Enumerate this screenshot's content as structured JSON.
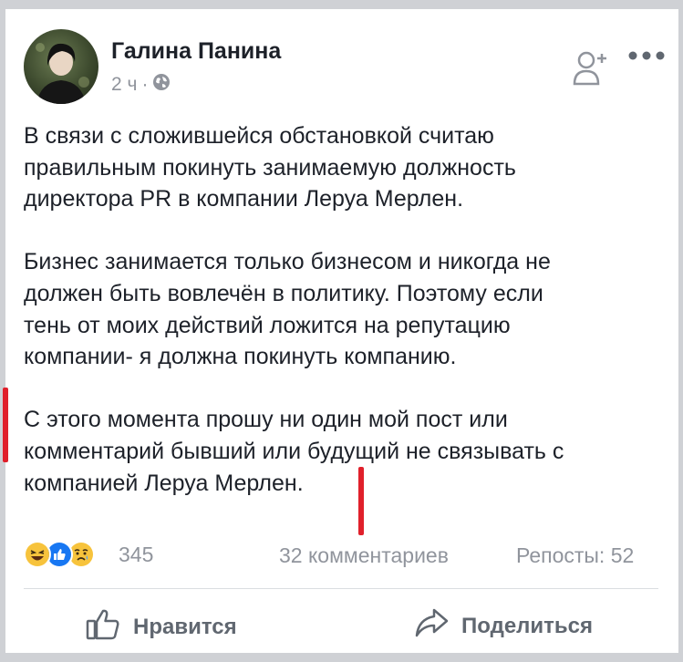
{
  "post": {
    "author": "Галина Панина",
    "time": "2 ч",
    "separator": "·",
    "privacy_icon": "globe-icon",
    "paragraphs": [
      "В связи с сложившейся обстановкой считаю\nправильным покинуть занимаемую должность\nдиректора PR в компании Леруа Мерлен.",
      "Бизнес занимается только бизнесом и никогда не\nдолжен быть вовлечён в политику. Поэтому если\nтень от моих действий ложится на репутацию\nкомпании- я должна покинуть компанию.",
      "С этого момента прошу ни один мой пост или\nкомментарий бывший или будущий не связывать с\nкомпанией Леруа Мерлен."
    ]
  },
  "stats": {
    "reactions": [
      "laughing-face-icon",
      "like-thumb-icon",
      "sad-face-icon"
    ],
    "reactions_count": "345",
    "comments": "32 комментариев",
    "shares": "Репосты: 52"
  },
  "actions": {
    "like_label": "Нравится",
    "share_label": "Поделиться"
  },
  "colors": {
    "text": "#1d2129",
    "secondary": "#90949c",
    "action": "#606770",
    "like_blue": "#1877f2",
    "emoji_yellow": "#f7c33c",
    "annotation_red": "#e0202b"
  }
}
